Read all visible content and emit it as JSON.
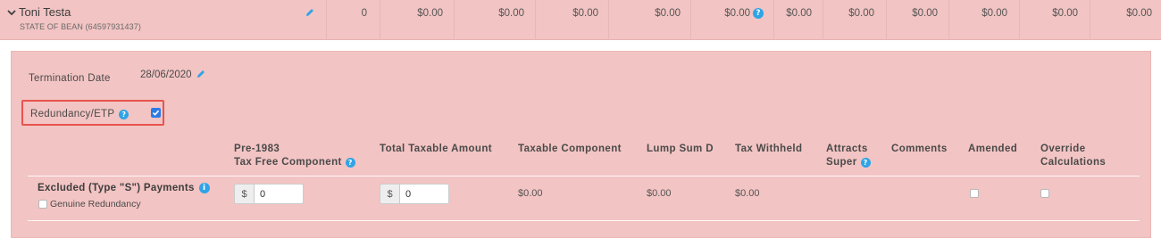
{
  "employee": {
    "name": "Toni Testa",
    "subtitle": "STATE OF BEAN (64597931437)",
    "values": [
      "0",
      "$0.00",
      "$0.00",
      "$0.00",
      "$0.00",
      "$0.00",
      "$0.00",
      "$0.00",
      "$0.00",
      "$0.00",
      "$0.00",
      "$0.00"
    ]
  },
  "detail": {
    "termination_label": "Termination Date",
    "termination_value": "28/06/2020",
    "redundancy_label": "Redundancy/ETP",
    "redundancy_checked": true,
    "columns": {
      "pre1983_line1": "Pre-1983",
      "pre1983_line2": "Tax Free Component",
      "total_taxable": "Total Taxable Amount",
      "taxable_component": "Taxable Component",
      "lump_sum_d": "Lump Sum D",
      "tax_withheld": "Tax Withheld",
      "attracts_line1": "Attracts",
      "attracts_line2": "Super",
      "comments": "Comments",
      "amended": "Amended",
      "override_line1": "Override",
      "override_line2": "Calculations"
    },
    "row": {
      "label": "Excluded (Type \"S\") Payments",
      "genuine_label": "Genuine Redundancy",
      "currency": "$",
      "pre1983_value": "0",
      "total_taxable_value": "0",
      "taxable_component": "$0.00",
      "lump_sum_d": "$0.00",
      "tax_withheld": "$0.00"
    }
  },
  "colors": {
    "panel_bg": "#f2c4c3",
    "accent_blue": "#2fa4e7",
    "highlight_red": "#e8534d"
  },
  "icons": [
    "chevron-down-icon",
    "pencil-icon",
    "help-icon",
    "info-icon",
    "checkbox-icon"
  ]
}
